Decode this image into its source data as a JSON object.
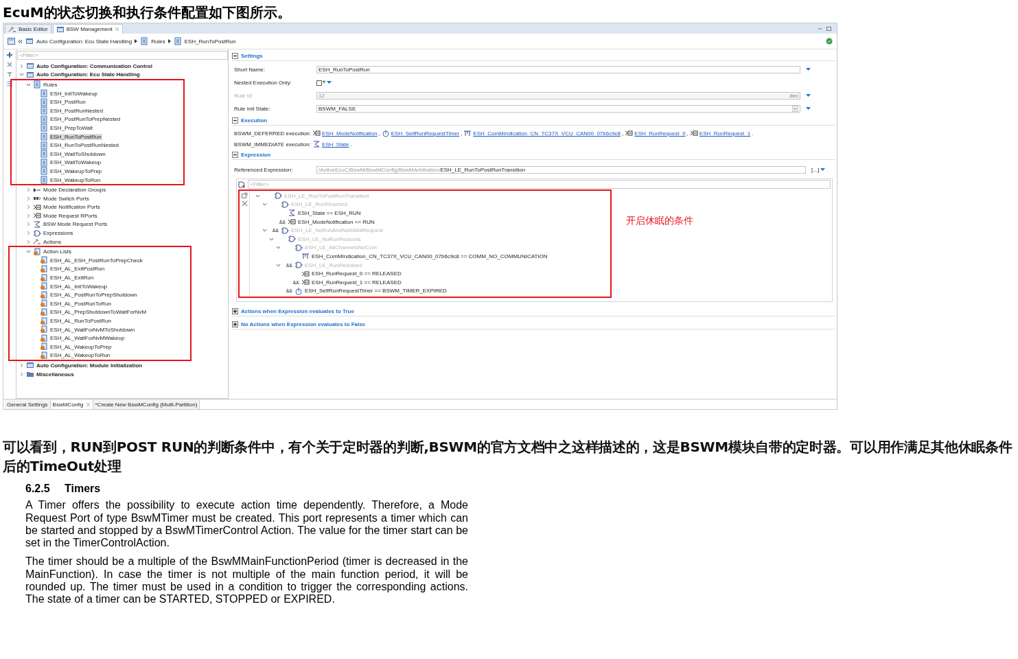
{
  "heading": "EcuM的状态切换和执行条件配置如下图所示。",
  "editor": {
    "tabs": [
      {
        "label": "Basic Editor",
        "selected": false,
        "closable": false
      },
      {
        "label": "BSW Management",
        "selected": true,
        "closable": true
      }
    ],
    "breadcrumb": [
      "Auto Configuration: Ecu State Handling",
      "Rules",
      "ESH_RunToPostRun"
    ],
    "tree_filter": {
      "placeholder": "<Filter>"
    },
    "tree": [
      {
        "label": "Auto Configuration: Communication Control",
        "kind": "config",
        "expanded": false,
        "selected": false
      },
      {
        "label": "Auto Configuration: Ecu State Handling",
        "kind": "config",
        "expanded": true,
        "selected": false,
        "children": [
          {
            "label": "Rules",
            "kind": "rules",
            "expanded": true,
            "selected": false,
            "highlighted": true,
            "children": [
              {
                "label": "ESH_InitToWakeup",
                "kind": "rule",
                "selected": false
              },
              {
                "label": "ESH_PostRun",
                "kind": "rule",
                "selected": false
              },
              {
                "label": "ESH_PostRunNested",
                "kind": "rule",
                "selected": false
              },
              {
                "label": "ESH_PostRunToPrepNested",
                "kind": "rule",
                "selected": false
              },
              {
                "label": "ESH_PrepToWait",
                "kind": "rule",
                "selected": false
              },
              {
                "label": "ESH_RunToPostRun",
                "kind": "rule",
                "selected": true
              },
              {
                "label": "ESH_RunToPostRunNested",
                "kind": "rule",
                "selected": false
              },
              {
                "label": "ESH_WaitToShutdown",
                "kind": "rule",
                "selected": false
              },
              {
                "label": "ESH_WaitToWakeup",
                "kind": "rule",
                "selected": false
              },
              {
                "label": "ESH_WakeupToPrep",
                "kind": "rule",
                "selected": false
              },
              {
                "label": "ESH_WakeupToRun",
                "kind": "rule",
                "selected": false
              }
            ]
          },
          {
            "label": "Mode Declaration Groups",
            "kind": "mode_group",
            "expanded": false,
            "selected": false
          },
          {
            "label": "Mode Switch Ports",
            "kind": "switch_port",
            "expanded": false,
            "selected": false
          },
          {
            "label": "Mode Notification Ports",
            "kind": "port",
            "expanded": false,
            "selected": false
          },
          {
            "label": "Mode Request RPorts",
            "kind": "port",
            "expanded": false,
            "selected": false
          },
          {
            "label": "BSW Mode Request Ports",
            "kind": "bsw_port",
            "expanded": false,
            "selected": false
          },
          {
            "label": "Expressions",
            "kind": "expression",
            "expanded": false,
            "selected": false
          },
          {
            "label": "Actions",
            "kind": "action",
            "expanded": false,
            "selected": false
          },
          {
            "label": "Action Lists",
            "kind": "action_list",
            "expanded": true,
            "selected": false,
            "highlighted": true,
            "children": [
              {
                "label": "ESH_AL_ESH_PostRunToPrepCheck",
                "kind": "action_list",
                "selected": false
              },
              {
                "label": "ESH_AL_ExitPostRun",
                "kind": "action_list",
                "selected": false
              },
              {
                "label": "ESH_AL_ExitRun",
                "kind": "action_list",
                "selected": false
              },
              {
                "label": "ESH_AL_InitToWakeup",
                "kind": "action_list",
                "selected": false
              },
              {
                "label": "ESH_AL_PostRunToPrepShutdown",
                "kind": "action_list",
                "selected": false
              },
              {
                "label": "ESH_AL_PostRunToRun",
                "kind": "action_list",
                "selected": false
              },
              {
                "label": "ESH_AL_PrepShutdownToWaitForNvM",
                "kind": "action_list",
                "selected": false
              },
              {
                "label": "ESH_AL_RunToPostRun",
                "kind": "action_list",
                "selected": false
              },
              {
                "label": "ESH_AL_WaitForNvMToShutdown",
                "kind": "action_list",
                "selected": false
              },
              {
                "label": "ESH_AL_WaitForNvMWakeup",
                "kind": "action_list",
                "selected": false
              },
              {
                "label": "ESH_AL_WakeupToPrep",
                "kind": "action_list",
                "selected": false
              },
              {
                "label": "ESH_AL_WakeupToRun",
                "kind": "action_list",
                "selected": false
              }
            ]
          }
        ]
      },
      {
        "label": "Auto Configuration: Module Initialization",
        "kind": "config",
        "expanded": false,
        "selected": false
      },
      {
        "label": "Miscellaneous",
        "kind": "folder",
        "expanded": false,
        "selected": false
      }
    ],
    "settings": {
      "title": "Settings",
      "expanded": true,
      "fields": [
        {
          "kind": "text",
          "label": "Short Name:",
          "value": "ESH_RunToPostRun",
          "disabled": false
        },
        {
          "kind": "checkbox",
          "label": "Nested Execution Only:",
          "checked": false,
          "disabled": false
        },
        {
          "kind": "number",
          "label": "Rule Id:",
          "value": "12",
          "unit": "dec",
          "disabled": true
        },
        {
          "kind": "select",
          "label": "Rule Init State:",
          "value": "BSWM_FALSE",
          "disabled": false
        }
      ]
    },
    "execution": {
      "title": "Execution",
      "expanded": true,
      "lines": [
        {
          "label": "BSWM_DEFERRED execution:",
          "refs": [
            {
              "text": "ESH_ModeNotification",
              "kind": "mode_port",
              "sep": ","
            },
            {
              "text": "ESH_SelfRunRequestTimer",
              "kind": "timer",
              "sep": ","
            },
            {
              "text": "ESH_ComMIndication_CN_TC37X_VCU_CAN00_07b6c9c8",
              "kind": "comm",
              "sep": ","
            },
            {
              "text": "ESH_RunRequest_0",
              "kind": "mode_port",
              "sep": ","
            },
            {
              "text": "ESH_RunRequest_1",
              "kind": "mode_port",
              "sep": "."
            }
          ]
        },
        {
          "label": "BSWM_IMMEDIATE execution:",
          "refs": [
            {
              "text": "ESH_State",
              "kind": "state",
              "sep": "."
            }
          ]
        }
      ]
    },
    "expression": {
      "title": "Expression",
      "expanded": true,
      "referenced_label": "Referenced Expression:",
      "referenced_path": "/ActiveEcuC/BswM/BswMConfig/BswMArbitration/",
      "referenced_name": "ESH_LE_RunToPostRunTransition",
      "browse": "[...]",
      "filter": {
        "placeholder": "<Filter>"
      },
      "highlighted": true,
      "annotation": "开启休眠的条件",
      "tree": [
        {
          "text": "ESH_LE_RunToPostRunTransition",
          "kind": "logical",
          "expanded": true,
          "children": [
            {
              "text": "ESH_LE_RunReached",
              "kind": "logical",
              "expanded": true,
              "children": [
                {
                  "text": "ESH_State == ESH_RUN",
                  "kind": "state"
                },
                {
                  "op": "&&",
                  "text": "ESH_ModeNotification == RUN",
                  "kind": "mode_port"
                }
              ]
            },
            {
              "op": "&&",
              "text": "ESH_LE_NoRunAndNoKillAllRequest",
              "kind": "logical",
              "expanded": true,
              "children": [
                {
                  "text": "ESH_LE_NoRunReasons",
                  "kind": "logical",
                  "expanded": true,
                  "children": [
                    {
                      "text": "ESH_LE_AllChannelsNoCom",
                      "kind": "logical",
                      "expanded": true,
                      "children": [
                        {
                          "text": "ESH_ComMIndication_CN_TC37X_VCU_CAN00_07b6c9c8 == COMM_NO_COMMUNICATION",
                          "kind": "comm"
                        }
                      ]
                    },
                    {
                      "op": "&&",
                      "text": "ESH_LE_RunReleased",
                      "kind": "logical",
                      "expanded": true,
                      "children": [
                        {
                          "text": "ESH_RunRequest_0 == RELEASED",
                          "kind": "mode_port"
                        },
                        {
                          "op": "&&",
                          "text": "ESH_RunRequest_1 == RELEASED",
                          "kind": "mode_port"
                        }
                      ]
                    },
                    {
                      "op": "&&",
                      "text": "ESH_SelfRunRequestTimer == BSWM_TIMER_EXPIRED",
                      "kind": "timer"
                    }
                  ]
                }
              ]
            }
          ]
        }
      ]
    },
    "collapsed_sections": [
      {
        "title": "Actions when Expression evaluates to True",
        "expanded": false
      },
      {
        "title": "No Actions when Expression evaluates to False",
        "expanded": false
      }
    ],
    "bottom_tabs": [
      {
        "label": "General Settings",
        "selected": false,
        "closable": false
      },
      {
        "label": "BswMConfig",
        "selected": true,
        "closable": true
      },
      {
        "label": "*Create New BswMConfig (Multi-Partition)",
        "selected": false,
        "closable": false
      }
    ]
  },
  "paragraph": "可以看到，RUN到POST RUN的判断条件中，有个关于定时器的判断,BSWM的官方文档中之这样描述的，这是BSWM模块自带的定时器。可以用作满足其他休眠条件后的TimeOut处理",
  "doc": {
    "number": "6.2.5",
    "title": "Timers",
    "paragraphs": [
      "A Timer offers the possibility to execute action time dependently. Therefore, a Mode Request Port of type BswMTimer must be created. This port represents a timer which can be started and stopped by a BswMTimerControl Action. The value for the timer start can be set in the TimerControlAction.",
      "The timer should be a multiple of the BswMMainFunctionPeriod (timer is decreased in the MainFunction). In case the timer is not multiple of the main function period, it will be rounded up.  The timer must be used in a condition to trigger the corresponding actions. The state of a timer can be STARTED, STOPPED or EXPIRED."
    ]
  }
}
